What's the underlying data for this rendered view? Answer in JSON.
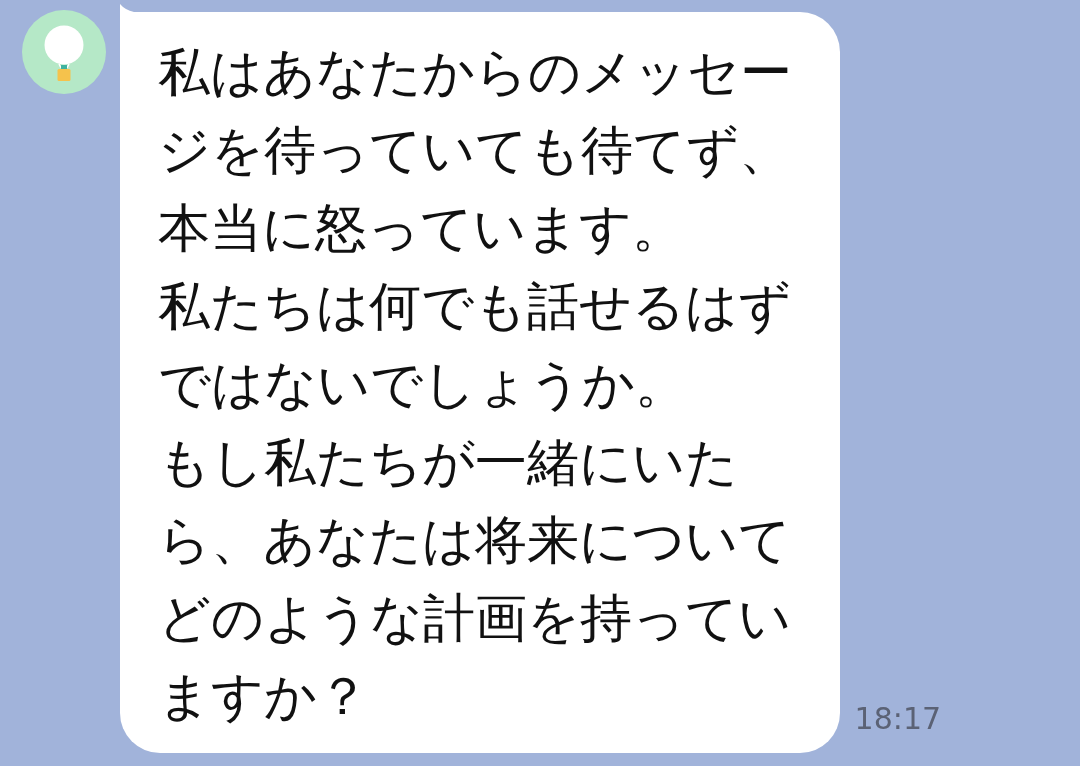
{
  "messages": [
    {
      "paragraphs": [
        "私はあなたからのメッセージを待っていても待てず、",
        "本当に怒っています。",
        "私たちは何でも話せるはずではないでしょうか。",
        "もし私たちが一緒にいたら、あなたは将来についてどのような計画を持っていますか？"
      ],
      "time": "18:17"
    }
  ]
}
